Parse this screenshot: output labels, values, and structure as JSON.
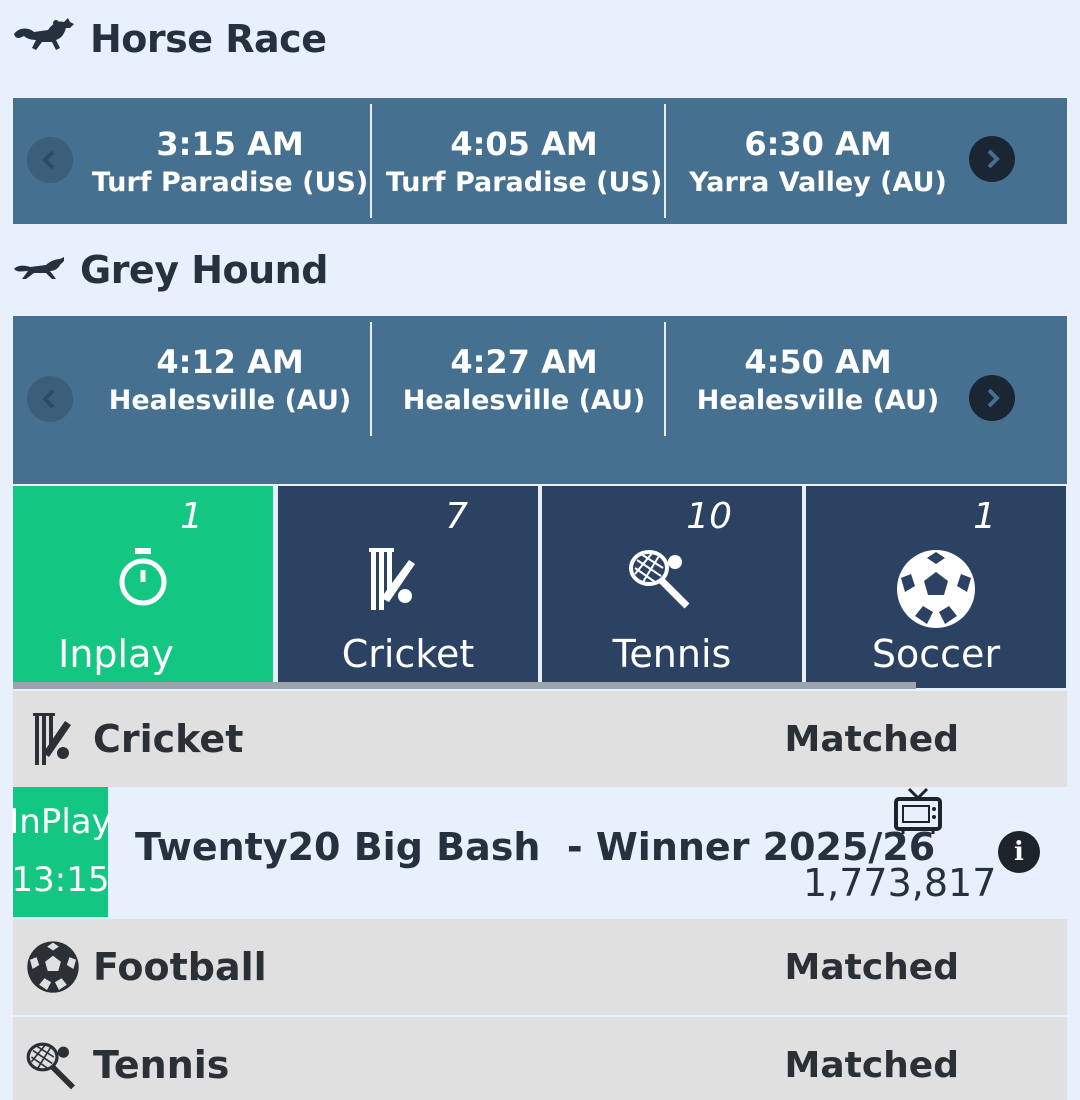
{
  "horse_race": {
    "title": "Horse Race",
    "races": [
      {
        "time": "3:15 AM",
        "venue": "Turf Paradise (US)"
      },
      {
        "time": "4:05 AM",
        "venue": "Turf Paradise (US)"
      },
      {
        "time": "6:30 AM",
        "venue": "Yarra Valley (AU)"
      }
    ]
  },
  "grey_hound": {
    "title": "Grey Hound",
    "races": [
      {
        "time": "4:12 AM",
        "venue": "Healesville (AU)"
      },
      {
        "time": "4:27 AM",
        "venue": "Healesville (AU)"
      },
      {
        "time": "4:50 AM",
        "venue": "Healesville (AU)"
      }
    ]
  },
  "sports_tabs": [
    {
      "label": "Inplay",
      "count": "1",
      "icon": "stopwatch-icon",
      "active": true
    },
    {
      "label": "Cricket",
      "count": "7",
      "icon": "cricket-icon",
      "active": false
    },
    {
      "label": "Tennis",
      "count": "10",
      "icon": "tennis-icon",
      "active": false
    },
    {
      "label": "Soccer",
      "count": "1",
      "icon": "soccer-ball-icon",
      "active": false
    }
  ],
  "categories": [
    {
      "name": "Cricket",
      "matched_label": "Matched",
      "icon": "cricket-icon"
    },
    {
      "name": "Football",
      "matched_label": "Matched",
      "icon": "soccer-ball-icon"
    },
    {
      "name": "Tennis",
      "matched_label": "Matched",
      "icon": "tennis-icon"
    }
  ],
  "event": {
    "status": "InPlay",
    "time": "13:15",
    "name": "Twenty20 Big Bash  - Winner 2025/26",
    "matched_amount": "1,773,817"
  },
  "colors": {
    "background": "#e8f0fb",
    "strip": "#46708f",
    "tile": "#2b4263",
    "active_tile": "#13c782",
    "category_row": "#e0e0e0"
  }
}
